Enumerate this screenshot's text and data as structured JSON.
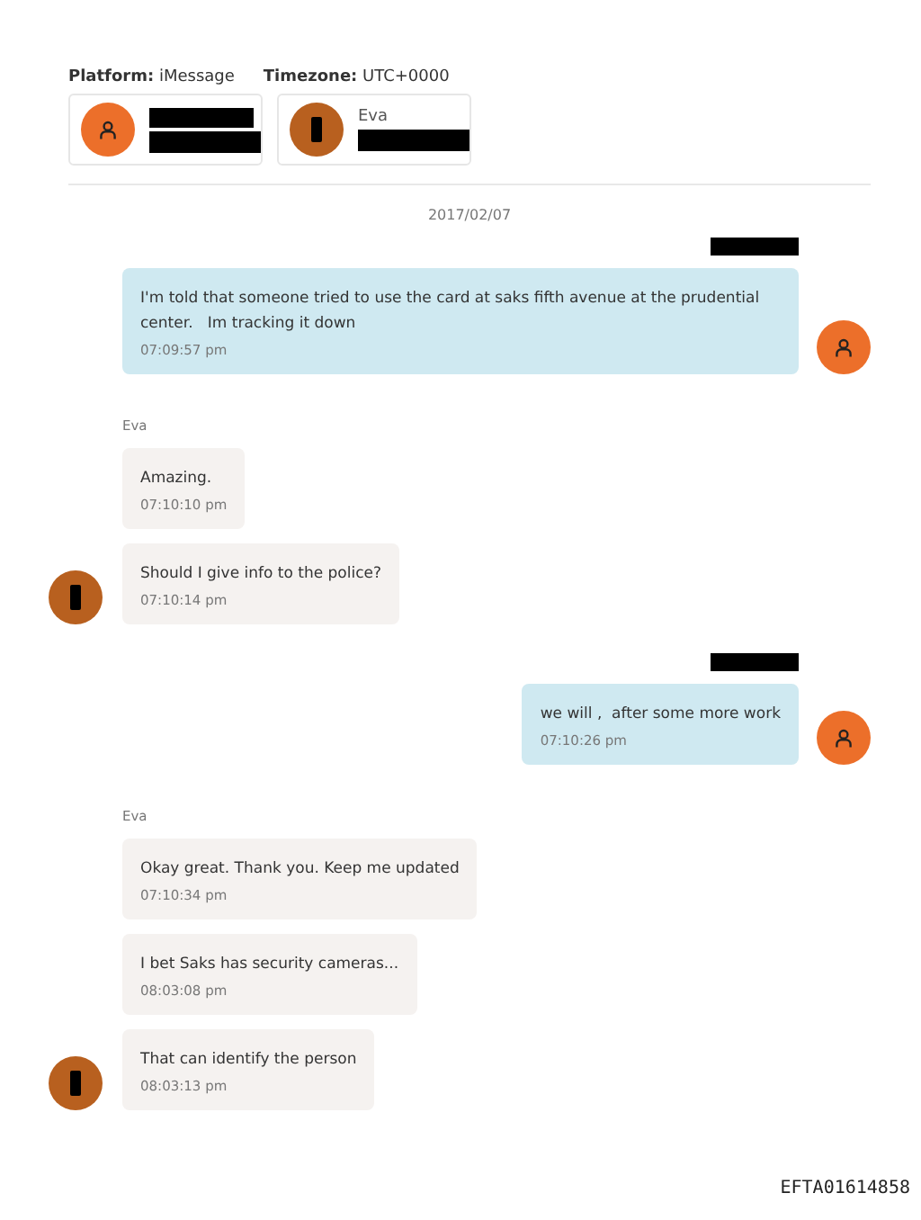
{
  "header": {
    "platform_label": "Platform:",
    "platform": "iMessage",
    "timezone_label": "Timezone:",
    "timezone": "UTC+0000"
  },
  "participants": [
    {
      "avatar": {
        "kind": "person"
      },
      "lines": [
        {
          "kind": "redacted"
        },
        {
          "kind": "redacted"
        }
      ]
    },
    {
      "avatar": {
        "kind": "redacted"
      },
      "lines": [
        {
          "kind": "text",
          "text": "Eva"
        },
        {
          "kind": "redacted"
        }
      ]
    }
  ],
  "date": "2017/02/07",
  "groups": [
    {
      "kind": "outgoing",
      "avatar": {
        "kind": "person"
      },
      "sender": {
        "kind": "redacted"
      },
      "messages": [
        {
          "text": "I'm told that someone tried to use the card at saks fifth avenue at the prudential center.   Im tracking it down",
          "time": "07:09:57 pm"
        }
      ]
    },
    {
      "kind": "incoming",
      "avatar": {
        "kind": "redacted"
      },
      "sender": {
        "kind": "text",
        "text": "Eva"
      },
      "messages": [
        {
          "text": "Amazing.",
          "time": "07:10:10 pm"
        },
        {
          "text": "Should I give info to the police?",
          "time": "07:10:14 pm"
        }
      ]
    },
    {
      "kind": "outgoing",
      "avatar": {
        "kind": "person"
      },
      "sender": {
        "kind": "redacted"
      },
      "messages": [
        {
          "text": "we will ,  after some more work",
          "time": "07:10:26 pm"
        }
      ]
    },
    {
      "kind": "incoming",
      "avatar": {
        "kind": "redacted"
      },
      "sender": {
        "kind": "text",
        "text": "Eva"
      },
      "messages": [
        {
          "text": "Okay great. Thank you. Keep me updated",
          "time": "07:10:34 pm"
        },
        {
          "text": "I bet Saks has security cameras...",
          "time": "08:03:08 pm"
        },
        {
          "text": "That can identify the person",
          "time": "08:03:13 pm"
        }
      ]
    }
  ],
  "stamp": "EFTA01614858"
}
